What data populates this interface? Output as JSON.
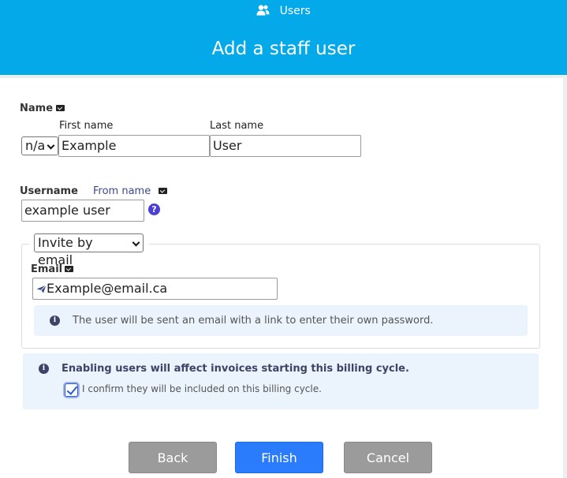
{
  "header": {
    "breadcrumb": "Users",
    "title": "Add a staff user",
    "breadcrumb_icon": "users-icon"
  },
  "name_section": {
    "label": "Name",
    "prefix_selected": "n/a",
    "first_name_label": "First name",
    "first_name_value": "Example",
    "last_name_label": "Last name",
    "last_name_value": "User"
  },
  "username_section": {
    "label": "Username",
    "from_name_link": "From name",
    "value": "example user",
    "help_glyph": "?"
  },
  "invite": {
    "method_selected": "Invite by email",
    "email_label": "Email",
    "email_value": "Example@email.ca",
    "info_text": "The user will be sent an email with a link to enter their own password."
  },
  "billing": {
    "notice": "Enabling users will affect invoices starting this billing cycle.",
    "confirm_label": "I confirm they will be included on this billing cycle.",
    "confirm_checked": true
  },
  "buttons": {
    "back": "Back",
    "finish": "Finish",
    "cancel": "Cancel"
  },
  "colors": {
    "header_bg": "#03a9e9",
    "primary_button": "#2b7bfd",
    "secondary_button": "#9b9b9b",
    "info_bg": "#ebf3fd"
  }
}
